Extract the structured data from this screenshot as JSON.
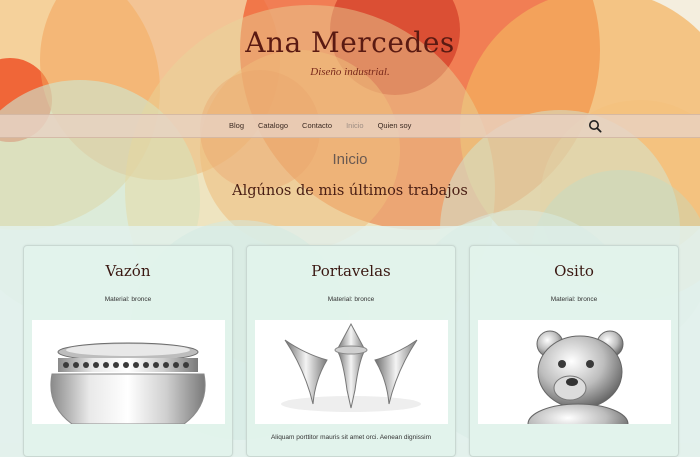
{
  "site": {
    "title": "Ana Mercedes",
    "description": "Diseño industrial."
  },
  "nav": {
    "items": [
      {
        "label": "Blog"
      },
      {
        "label": "Catalogo"
      },
      {
        "label": "Contacto"
      },
      {
        "label": "Inicio"
      },
      {
        "label": "Quien soy"
      }
    ],
    "active_item": "Inicio",
    "search_icon": "search-icon"
  },
  "page": {
    "title": "Inicio",
    "section_heading": "Algúnos de mis últimos trabajos"
  },
  "cards": [
    {
      "title": "Vazón",
      "meta": "Material: bronce",
      "image": "silver-pot-image"
    },
    {
      "title": "Portavelas",
      "meta": "Material: bronce",
      "image": "silver-candleholder-image",
      "excerpt": "Aliquam porttitor mauris sit amet orci. Aenean dignissim"
    },
    {
      "title": "Osito",
      "meta": "Material: bronce",
      "image": "silver-teddy-bear-image"
    }
  ],
  "colors": {
    "title": "#5a1a12",
    "nav_bg": "#e8d2c4",
    "card_bg": "#e2f3ec",
    "accent_orange": "#f06a3c",
    "accent_yellow": "#f2b65a"
  }
}
